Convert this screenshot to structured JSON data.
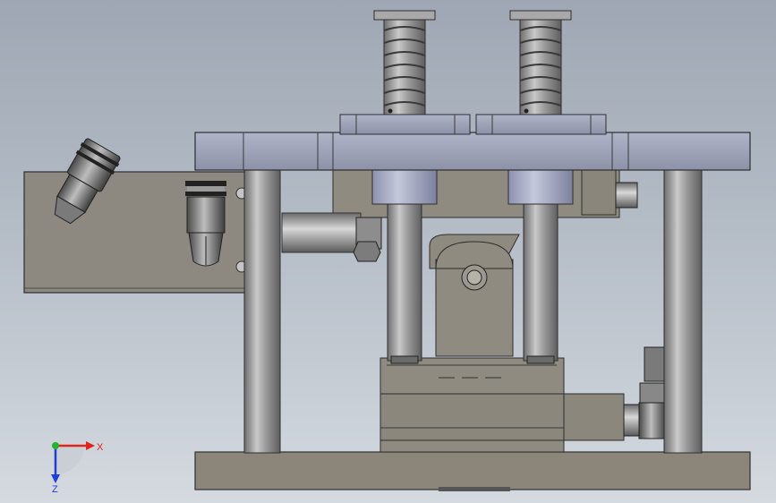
{
  "triad": {
    "x_label": "X",
    "z_label": "Z",
    "x_color": "#e0241b",
    "y_color": "#25b233",
    "z_color": "#1e3fd6"
  },
  "colors": {
    "background_top": "#9ea7b3",
    "background_bottom": "#d5dae0",
    "metal": "#8f8a80",
    "plate_blue": "#9aa0b8",
    "steel": "#a8a8a8"
  }
}
